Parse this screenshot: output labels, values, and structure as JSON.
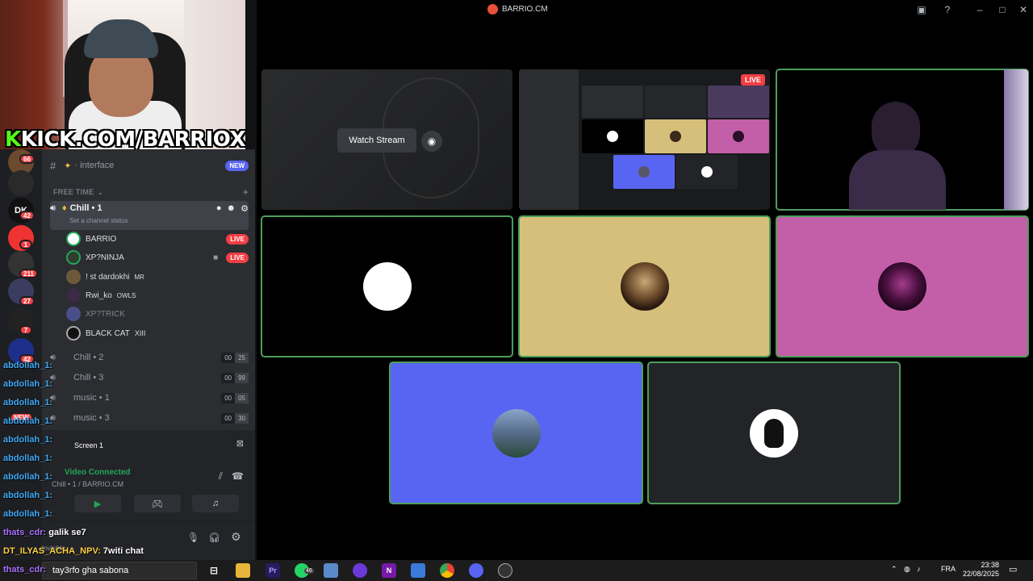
{
  "window": {
    "title": "BARRIO.CM"
  },
  "overlay": {
    "kick_prefix": "K",
    "kick_text": "KICK.COM/BARRIOX"
  },
  "servers": [
    {
      "label": "",
      "badge": "66"
    },
    {
      "label": "",
      "badge": ""
    },
    {
      "label": "DK",
      "badge": "42"
    },
    {
      "label": "",
      "badge": "1"
    },
    {
      "label": "",
      "badge": "211"
    },
    {
      "label": "",
      "badge": "27"
    },
    {
      "label": "",
      "badge": "7"
    },
    {
      "label": "",
      "badge": "42"
    },
    {
      "label": "",
      "badge": "NEW"
    }
  ],
  "channels": {
    "interface_label": "· interface",
    "interface_badge": "NEW",
    "category": "FREE TIME",
    "active_voice": "Chill • 1",
    "set_status": "Set a channel status",
    "members": [
      {
        "name": "BARRIO",
        "tag": "",
        "live": "LIVE"
      },
      {
        "name": "XP?NINJA",
        "tag": "",
        "live": "LIVE"
      },
      {
        "name": "! st dardokhi",
        "tag": "MR",
        "live": ""
      },
      {
        "name": "Rwi_ko",
        "tag": "OWLS",
        "live": ""
      },
      {
        "name": "XP?TRICK",
        "tag": "",
        "live": ""
      },
      {
        "name": "BLACK CAT",
        "tag": "XIII",
        "live": ""
      }
    ],
    "other_voice": [
      {
        "name": "Chill • 2",
        "a": "00",
        "b": "25"
      },
      {
        "name": "Chill • 3",
        "a": "00",
        "b": "99"
      },
      {
        "name": "music • 1",
        "a": "00",
        "b": "05"
      },
      {
        "name": "music • 3",
        "a": "00",
        "b": "30"
      }
    ]
  },
  "voice_panel": {
    "screen_label": "Screen 1",
    "connected": "Video Connected",
    "location": "Chill • 1 / BARRIO.CM"
  },
  "user_panel": {
    "status": "Invisible"
  },
  "chat": [
    {
      "name": "abdollah_1:",
      "msg": ""
    },
    {
      "name": "abdollah_1:",
      "msg": ""
    },
    {
      "name": "abdollah_1:",
      "msg": ""
    },
    {
      "name": "abdollah_1:",
      "msg": ""
    },
    {
      "name": "abdollah_1:",
      "msg": ""
    },
    {
      "name": "abdollah_1:",
      "msg": ""
    },
    {
      "name": "abdollah_1:",
      "msg": ""
    },
    {
      "name": "abdollah_1:",
      "msg": ""
    },
    {
      "name": "abdollah_1:",
      "msg": ""
    },
    {
      "name": "thats_cdr:",
      "msg": "galik se7"
    },
    {
      "name": "DT_ILYAS_ACHA_NPV:",
      "msg": "7witi chat"
    },
    {
      "name": "thats_cdr:",
      "msg": "tay3rfo gha sabona"
    }
  ],
  "stage": {
    "watch_stream": "Watch Stream",
    "live_tag": "LIVE",
    "colors": {
      "black_tile": "#000000",
      "tan_tile": "#d6bf7a",
      "pink_tile": "#c35ea8",
      "blue_tile": "#5865f2",
      "dark_tile": "#232428",
      "speaking": "#4d9e5a"
    }
  },
  "taskbar": {
    "whatsapp_badge": "46",
    "language": "FRA",
    "time": "23:38",
    "date": "22/08/2025"
  }
}
